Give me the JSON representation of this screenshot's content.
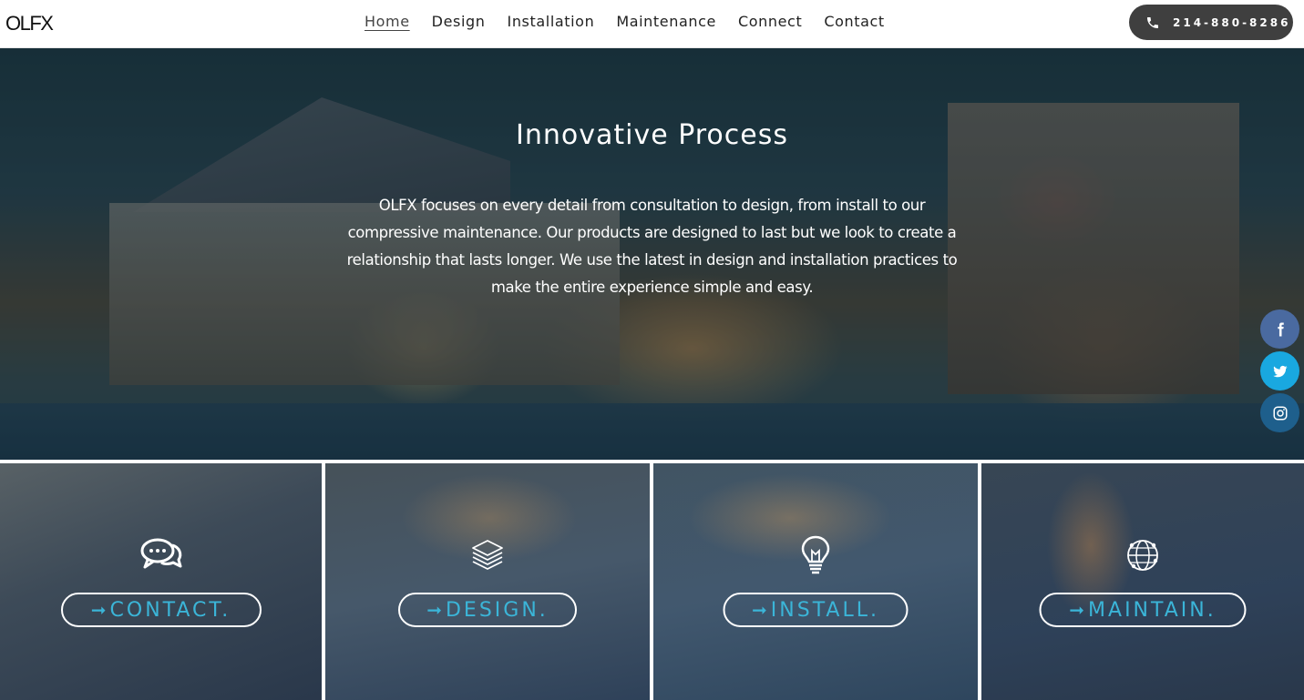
{
  "header": {
    "logo": "OLFX",
    "nav": [
      {
        "label": "Home",
        "active": true
      },
      {
        "label": "Design"
      },
      {
        "label": "Installation"
      },
      {
        "label": "Maintenance"
      },
      {
        "label": "Connect"
      },
      {
        "label": "Contact"
      }
    ],
    "phone": {
      "icon": "phone-icon",
      "number": "214-880-8286"
    }
  },
  "hero": {
    "title": "Innovative Process",
    "text": "OLFX focuses on every detail from consultation to design, from install to our compressive maintenance. Our products are designed to last but we look to create a relationship that lasts longer. We use the latest in design and installation practices to make the entire experience simple and easy."
  },
  "social": [
    {
      "icon": "facebook-icon",
      "color": "#4a6aa0"
    },
    {
      "icon": "twitter-icon",
      "color": "#19a8e0"
    },
    {
      "icon": "instagram-icon",
      "color": "#1e5f8c"
    }
  ],
  "tiles": [
    {
      "icon": "chat-bubbles-icon",
      "arrow": "➞",
      "label": "CONTACT."
    },
    {
      "icon": "layers-icon",
      "arrow": "➞",
      "label": "DESIGN."
    },
    {
      "icon": "lightbulb-icon",
      "arrow": "➞",
      "label": "INSTALL."
    },
    {
      "icon": "globe-network-icon",
      "arrow": "➞",
      "label": "MAINTAIN."
    }
  ],
  "colors": {
    "accent": "#3bb5d8",
    "phone_button": "#3f3f3f"
  }
}
